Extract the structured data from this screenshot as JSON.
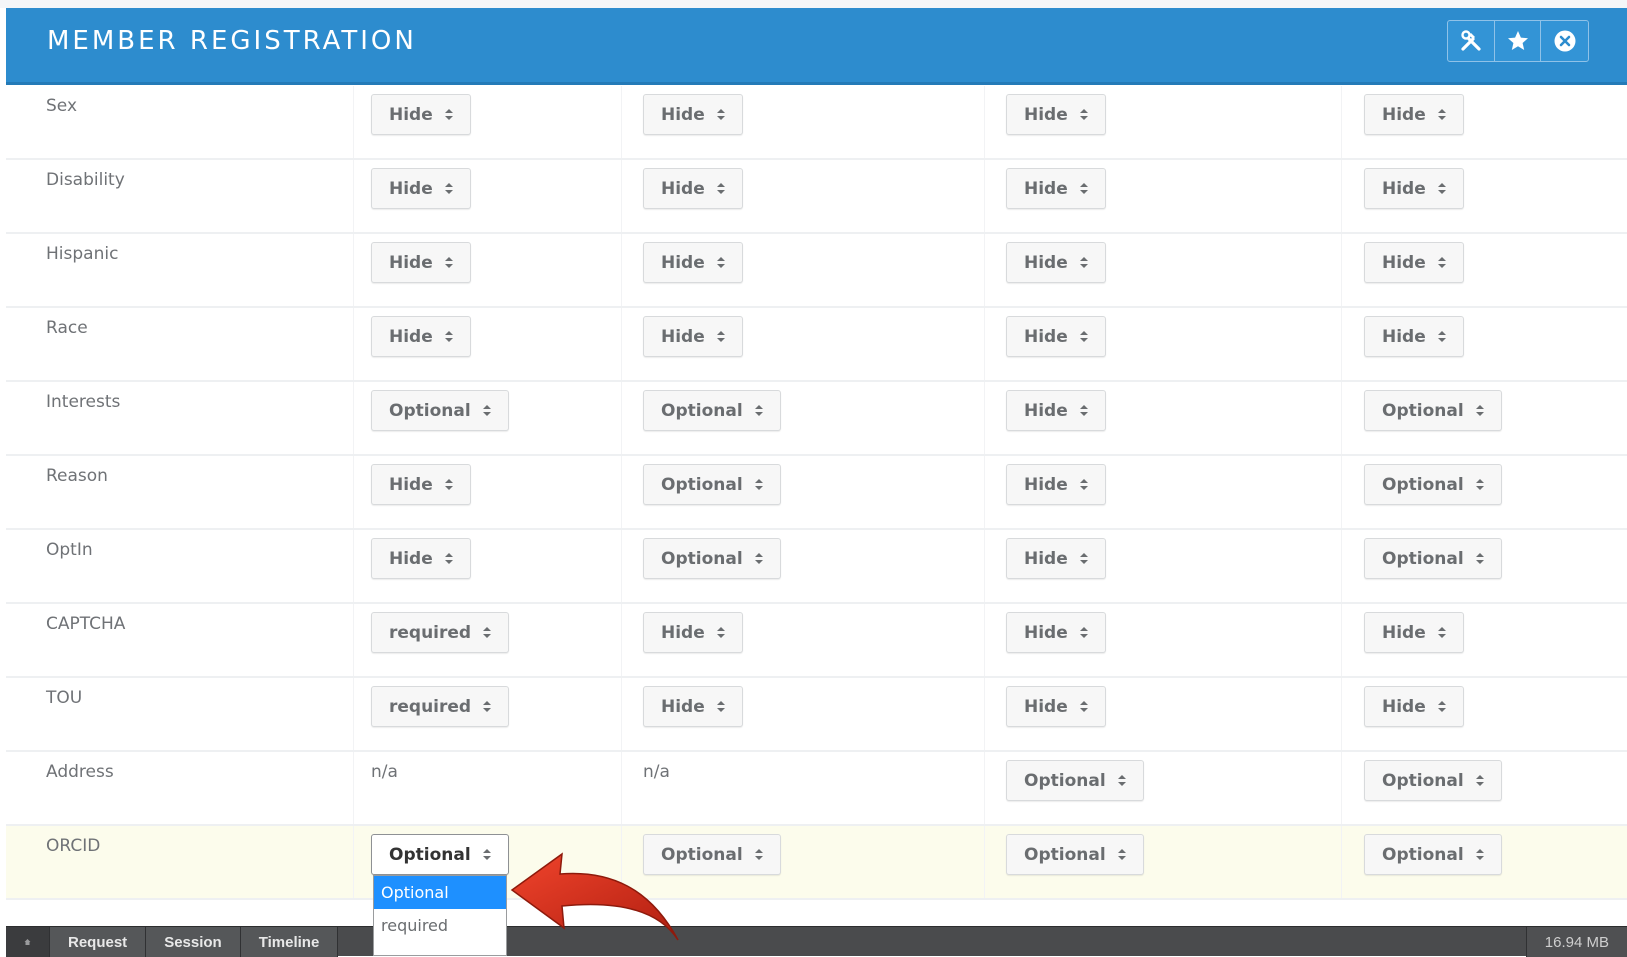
{
  "header": {
    "title": "MEMBER REGISTRATION",
    "tools": [
      "tools-icon",
      "star-icon",
      "close-icon"
    ]
  },
  "rows": [
    {
      "label": "Sex",
      "values": [
        "Hide",
        "Hide",
        "Hide",
        "Hide"
      ]
    },
    {
      "label": "Disability",
      "values": [
        "Hide",
        "Hide",
        "Hide",
        "Hide"
      ]
    },
    {
      "label": "Hispanic",
      "values": [
        "Hide",
        "Hide",
        "Hide",
        "Hide"
      ]
    },
    {
      "label": "Race",
      "values": [
        "Hide",
        "Hide",
        "Hide",
        "Hide"
      ]
    },
    {
      "label": "Interests",
      "values": [
        "Optional",
        "Optional",
        "Hide",
        "Optional"
      ]
    },
    {
      "label": "Reason",
      "values": [
        "Hide",
        "Optional",
        "Hide",
        "Optional"
      ]
    },
    {
      "label": "OptIn",
      "values": [
        "Hide",
        "Optional",
        "Hide",
        "Optional"
      ]
    },
    {
      "label": "CAPTCHA",
      "values": [
        "required",
        "Hide",
        "Hide",
        "Hide"
      ]
    },
    {
      "label": "TOU",
      "values": [
        "required",
        "Hide",
        "Hide",
        "Hide"
      ]
    },
    {
      "label": "Address",
      "values": [
        "n/a",
        "n/a",
        "Optional",
        "Optional"
      ]
    },
    {
      "label": "ORCID",
      "values": [
        "Optional",
        "Optional",
        "Optional",
        "Optional"
      ]
    }
  ],
  "dropdown": {
    "options": [
      "Optional",
      "required"
    ],
    "selected": "Optional"
  },
  "debugbar": {
    "items": [
      "Request",
      "Session",
      "Timeline"
    ],
    "memory": "16.94 MB"
  },
  "colors": {
    "header": "#2d8cce",
    "highlight_row": "#fcfcec",
    "dropdown_selected": "#1e90ff",
    "arrow": "#e0301e"
  }
}
